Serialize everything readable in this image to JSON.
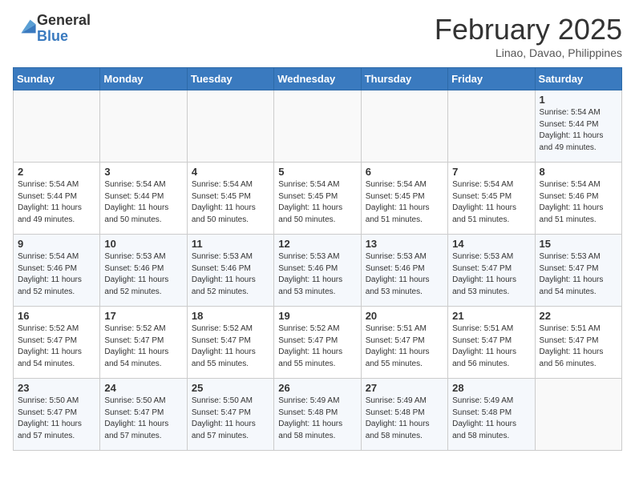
{
  "header": {
    "logo_line1": "General",
    "logo_line2": "Blue",
    "title": "February 2025",
    "subtitle": "Linao, Davao, Philippines"
  },
  "weekdays": [
    "Sunday",
    "Monday",
    "Tuesday",
    "Wednesday",
    "Thursday",
    "Friday",
    "Saturday"
  ],
  "weeks": [
    [
      {
        "day": "",
        "info": ""
      },
      {
        "day": "",
        "info": ""
      },
      {
        "day": "",
        "info": ""
      },
      {
        "day": "",
        "info": ""
      },
      {
        "day": "",
        "info": ""
      },
      {
        "day": "",
        "info": ""
      },
      {
        "day": "1",
        "info": "Sunrise: 5:54 AM\nSunset: 5:44 PM\nDaylight: 11 hours\nand 49 minutes."
      }
    ],
    [
      {
        "day": "2",
        "info": "Sunrise: 5:54 AM\nSunset: 5:44 PM\nDaylight: 11 hours\nand 49 minutes."
      },
      {
        "day": "3",
        "info": "Sunrise: 5:54 AM\nSunset: 5:44 PM\nDaylight: 11 hours\nand 50 minutes."
      },
      {
        "day": "4",
        "info": "Sunrise: 5:54 AM\nSunset: 5:45 PM\nDaylight: 11 hours\nand 50 minutes."
      },
      {
        "day": "5",
        "info": "Sunrise: 5:54 AM\nSunset: 5:45 PM\nDaylight: 11 hours\nand 50 minutes."
      },
      {
        "day": "6",
        "info": "Sunrise: 5:54 AM\nSunset: 5:45 PM\nDaylight: 11 hours\nand 51 minutes."
      },
      {
        "day": "7",
        "info": "Sunrise: 5:54 AM\nSunset: 5:45 PM\nDaylight: 11 hours\nand 51 minutes."
      },
      {
        "day": "8",
        "info": "Sunrise: 5:54 AM\nSunset: 5:46 PM\nDaylight: 11 hours\nand 51 minutes."
      }
    ],
    [
      {
        "day": "9",
        "info": "Sunrise: 5:54 AM\nSunset: 5:46 PM\nDaylight: 11 hours\nand 52 minutes."
      },
      {
        "day": "10",
        "info": "Sunrise: 5:53 AM\nSunset: 5:46 PM\nDaylight: 11 hours\nand 52 minutes."
      },
      {
        "day": "11",
        "info": "Sunrise: 5:53 AM\nSunset: 5:46 PM\nDaylight: 11 hours\nand 52 minutes."
      },
      {
        "day": "12",
        "info": "Sunrise: 5:53 AM\nSunset: 5:46 PM\nDaylight: 11 hours\nand 53 minutes."
      },
      {
        "day": "13",
        "info": "Sunrise: 5:53 AM\nSunset: 5:46 PM\nDaylight: 11 hours\nand 53 minutes."
      },
      {
        "day": "14",
        "info": "Sunrise: 5:53 AM\nSunset: 5:47 PM\nDaylight: 11 hours\nand 53 minutes."
      },
      {
        "day": "15",
        "info": "Sunrise: 5:53 AM\nSunset: 5:47 PM\nDaylight: 11 hours\nand 54 minutes."
      }
    ],
    [
      {
        "day": "16",
        "info": "Sunrise: 5:52 AM\nSunset: 5:47 PM\nDaylight: 11 hours\nand 54 minutes."
      },
      {
        "day": "17",
        "info": "Sunrise: 5:52 AM\nSunset: 5:47 PM\nDaylight: 11 hours\nand 54 minutes."
      },
      {
        "day": "18",
        "info": "Sunrise: 5:52 AM\nSunset: 5:47 PM\nDaylight: 11 hours\nand 55 minutes."
      },
      {
        "day": "19",
        "info": "Sunrise: 5:52 AM\nSunset: 5:47 PM\nDaylight: 11 hours\nand 55 minutes."
      },
      {
        "day": "20",
        "info": "Sunrise: 5:51 AM\nSunset: 5:47 PM\nDaylight: 11 hours\nand 55 minutes."
      },
      {
        "day": "21",
        "info": "Sunrise: 5:51 AM\nSunset: 5:47 PM\nDaylight: 11 hours\nand 56 minutes."
      },
      {
        "day": "22",
        "info": "Sunrise: 5:51 AM\nSunset: 5:47 PM\nDaylight: 11 hours\nand 56 minutes."
      }
    ],
    [
      {
        "day": "23",
        "info": "Sunrise: 5:50 AM\nSunset: 5:47 PM\nDaylight: 11 hours\nand 57 minutes."
      },
      {
        "day": "24",
        "info": "Sunrise: 5:50 AM\nSunset: 5:47 PM\nDaylight: 11 hours\nand 57 minutes."
      },
      {
        "day": "25",
        "info": "Sunrise: 5:50 AM\nSunset: 5:47 PM\nDaylight: 11 hours\nand 57 minutes."
      },
      {
        "day": "26",
        "info": "Sunrise: 5:49 AM\nSunset: 5:48 PM\nDaylight: 11 hours\nand 58 minutes."
      },
      {
        "day": "27",
        "info": "Sunrise: 5:49 AM\nSunset: 5:48 PM\nDaylight: 11 hours\nand 58 minutes."
      },
      {
        "day": "28",
        "info": "Sunrise: 5:49 AM\nSunset: 5:48 PM\nDaylight: 11 hours\nand 58 minutes."
      },
      {
        "day": "",
        "info": ""
      }
    ]
  ]
}
